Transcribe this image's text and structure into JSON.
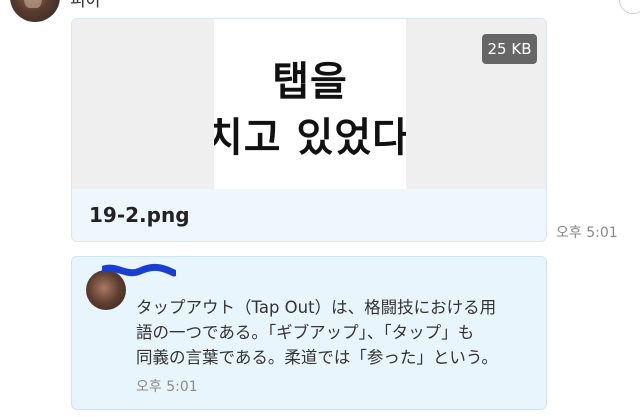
{
  "sender": {
    "name": "피아"
  },
  "message": {
    "preview": {
      "line1": "탭을",
      "line2": "치고 있었다"
    },
    "file_size": "25 KB",
    "file_name": "19-2.png",
    "time": "오후 5:01"
  },
  "quoted_card": {
    "text_line1": "タップアウト（Tap Out）は、格闘技における用",
    "text_line2": "語の一つである。「ギブアップ」、「タップ」も",
    "text_line3": "同義の言葉である。柔道では「参った」という。",
    "time": "오후 5:01"
  },
  "colors": {
    "bubble_bg": "#eef7fd",
    "badge_bg": "#666666",
    "redaction": "#1a3fd0"
  }
}
